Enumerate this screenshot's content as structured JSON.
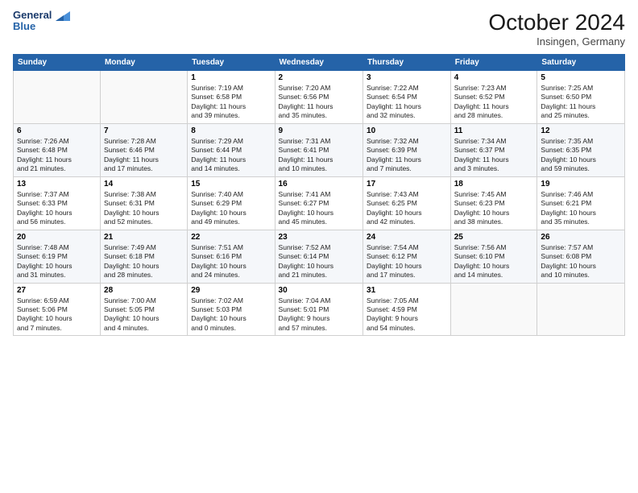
{
  "header": {
    "logo_line1": "General",
    "logo_line2": "Blue",
    "month": "October 2024",
    "location": "Insingen, Germany"
  },
  "days_of_week": [
    "Sunday",
    "Monday",
    "Tuesday",
    "Wednesday",
    "Thursday",
    "Friday",
    "Saturday"
  ],
  "weeks": [
    [
      {
        "num": "",
        "detail": ""
      },
      {
        "num": "",
        "detail": ""
      },
      {
        "num": "1",
        "detail": "Sunrise: 7:19 AM\nSunset: 6:58 PM\nDaylight: 11 hours\nand 39 minutes."
      },
      {
        "num": "2",
        "detail": "Sunrise: 7:20 AM\nSunset: 6:56 PM\nDaylight: 11 hours\nand 35 minutes."
      },
      {
        "num": "3",
        "detail": "Sunrise: 7:22 AM\nSunset: 6:54 PM\nDaylight: 11 hours\nand 32 minutes."
      },
      {
        "num": "4",
        "detail": "Sunrise: 7:23 AM\nSunset: 6:52 PM\nDaylight: 11 hours\nand 28 minutes."
      },
      {
        "num": "5",
        "detail": "Sunrise: 7:25 AM\nSunset: 6:50 PM\nDaylight: 11 hours\nand 25 minutes."
      }
    ],
    [
      {
        "num": "6",
        "detail": "Sunrise: 7:26 AM\nSunset: 6:48 PM\nDaylight: 11 hours\nand 21 minutes."
      },
      {
        "num": "7",
        "detail": "Sunrise: 7:28 AM\nSunset: 6:46 PM\nDaylight: 11 hours\nand 17 minutes."
      },
      {
        "num": "8",
        "detail": "Sunrise: 7:29 AM\nSunset: 6:44 PM\nDaylight: 11 hours\nand 14 minutes."
      },
      {
        "num": "9",
        "detail": "Sunrise: 7:31 AM\nSunset: 6:41 PM\nDaylight: 11 hours\nand 10 minutes."
      },
      {
        "num": "10",
        "detail": "Sunrise: 7:32 AM\nSunset: 6:39 PM\nDaylight: 11 hours\nand 7 minutes."
      },
      {
        "num": "11",
        "detail": "Sunrise: 7:34 AM\nSunset: 6:37 PM\nDaylight: 11 hours\nand 3 minutes."
      },
      {
        "num": "12",
        "detail": "Sunrise: 7:35 AM\nSunset: 6:35 PM\nDaylight: 10 hours\nand 59 minutes."
      }
    ],
    [
      {
        "num": "13",
        "detail": "Sunrise: 7:37 AM\nSunset: 6:33 PM\nDaylight: 10 hours\nand 56 minutes."
      },
      {
        "num": "14",
        "detail": "Sunrise: 7:38 AM\nSunset: 6:31 PM\nDaylight: 10 hours\nand 52 minutes."
      },
      {
        "num": "15",
        "detail": "Sunrise: 7:40 AM\nSunset: 6:29 PM\nDaylight: 10 hours\nand 49 minutes."
      },
      {
        "num": "16",
        "detail": "Sunrise: 7:41 AM\nSunset: 6:27 PM\nDaylight: 10 hours\nand 45 minutes."
      },
      {
        "num": "17",
        "detail": "Sunrise: 7:43 AM\nSunset: 6:25 PM\nDaylight: 10 hours\nand 42 minutes."
      },
      {
        "num": "18",
        "detail": "Sunrise: 7:45 AM\nSunset: 6:23 PM\nDaylight: 10 hours\nand 38 minutes."
      },
      {
        "num": "19",
        "detail": "Sunrise: 7:46 AM\nSunset: 6:21 PM\nDaylight: 10 hours\nand 35 minutes."
      }
    ],
    [
      {
        "num": "20",
        "detail": "Sunrise: 7:48 AM\nSunset: 6:19 PM\nDaylight: 10 hours\nand 31 minutes."
      },
      {
        "num": "21",
        "detail": "Sunrise: 7:49 AM\nSunset: 6:18 PM\nDaylight: 10 hours\nand 28 minutes."
      },
      {
        "num": "22",
        "detail": "Sunrise: 7:51 AM\nSunset: 6:16 PM\nDaylight: 10 hours\nand 24 minutes."
      },
      {
        "num": "23",
        "detail": "Sunrise: 7:52 AM\nSunset: 6:14 PM\nDaylight: 10 hours\nand 21 minutes."
      },
      {
        "num": "24",
        "detail": "Sunrise: 7:54 AM\nSunset: 6:12 PM\nDaylight: 10 hours\nand 17 minutes."
      },
      {
        "num": "25",
        "detail": "Sunrise: 7:56 AM\nSunset: 6:10 PM\nDaylight: 10 hours\nand 14 minutes."
      },
      {
        "num": "26",
        "detail": "Sunrise: 7:57 AM\nSunset: 6:08 PM\nDaylight: 10 hours\nand 10 minutes."
      }
    ],
    [
      {
        "num": "27",
        "detail": "Sunrise: 6:59 AM\nSunset: 5:06 PM\nDaylight: 10 hours\nand 7 minutes."
      },
      {
        "num": "28",
        "detail": "Sunrise: 7:00 AM\nSunset: 5:05 PM\nDaylight: 10 hours\nand 4 minutes."
      },
      {
        "num": "29",
        "detail": "Sunrise: 7:02 AM\nSunset: 5:03 PM\nDaylight: 10 hours\nand 0 minutes."
      },
      {
        "num": "30",
        "detail": "Sunrise: 7:04 AM\nSunset: 5:01 PM\nDaylight: 9 hours\nand 57 minutes."
      },
      {
        "num": "31",
        "detail": "Sunrise: 7:05 AM\nSunset: 4:59 PM\nDaylight: 9 hours\nand 54 minutes."
      },
      {
        "num": "",
        "detail": ""
      },
      {
        "num": "",
        "detail": ""
      }
    ]
  ]
}
